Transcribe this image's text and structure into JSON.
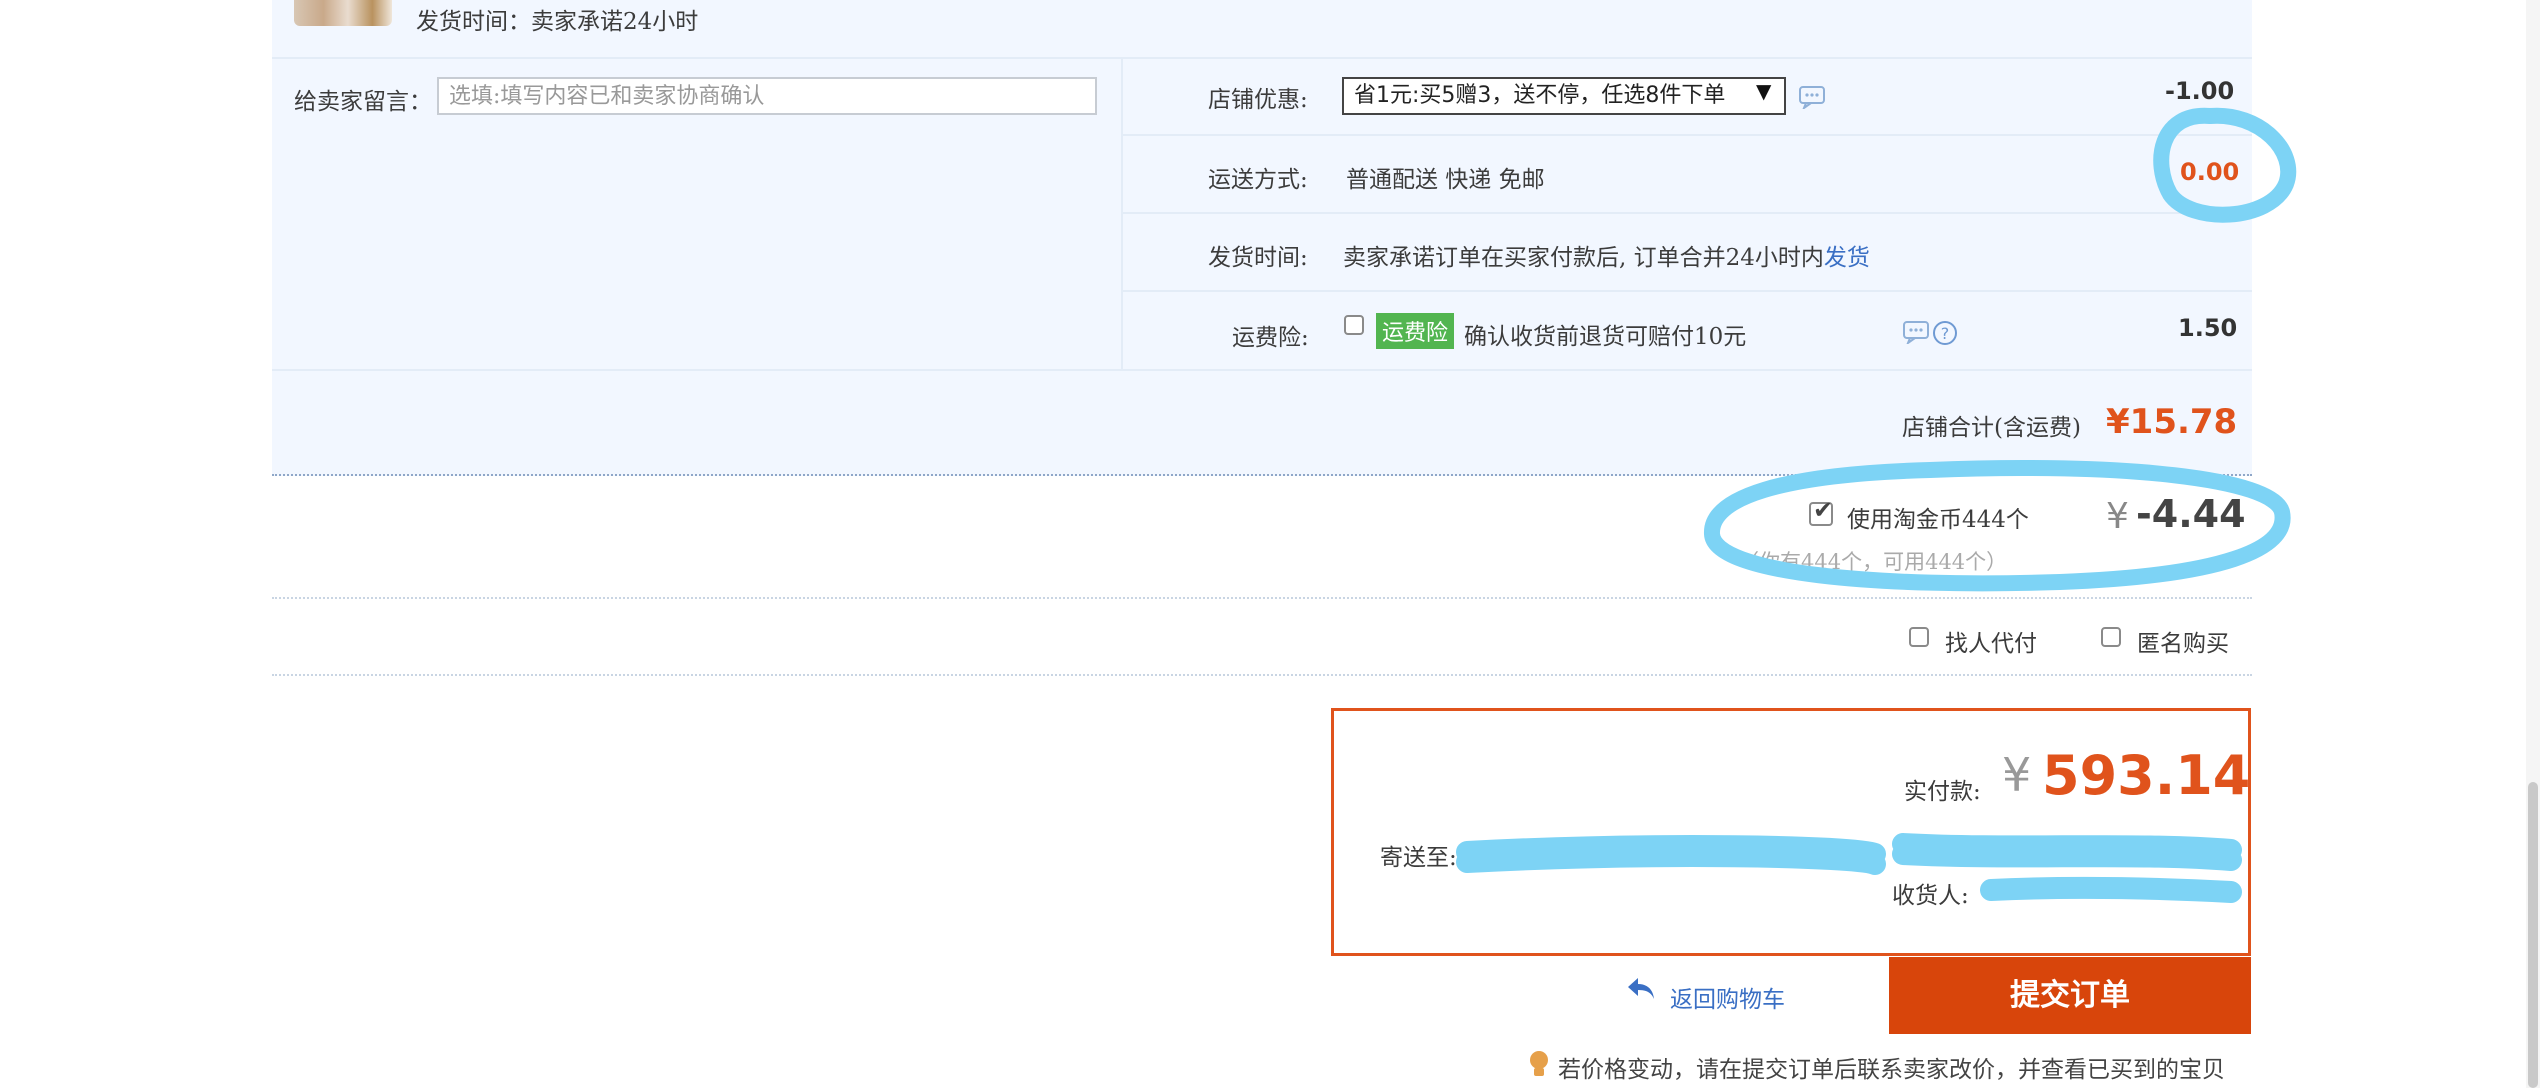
{
  "product": {
    "ship_time": "发货时间：卖家承诺24小时"
  },
  "message": {
    "label": "给卖家留言：",
    "placeholder": "选填:填写内容已和卖家协商确认"
  },
  "shop_discount": {
    "label": "店铺优惠:",
    "selected": "省1元:买5赠3，送不停，任选8件下单",
    "amount": "-1.00"
  },
  "shipping": {
    "label": "运送方式:",
    "value": "普通配送 快递 免邮",
    "amount": "0.00"
  },
  "delivery": {
    "label": "发货时间:",
    "value_prefix": "卖家承诺订单在买家付款后, 订单合并24小时内",
    "value_link": "发货"
  },
  "insurance": {
    "label": "运费险:",
    "badge": "运费险",
    "value": "确认收货前退货可赔付10元",
    "amount": "1.50"
  },
  "shop_total": {
    "label": "店铺合计(含运费)",
    "amount": "¥15.78"
  },
  "coins": {
    "label": "使用淘金币444个",
    "currency": "¥",
    "amount": "-4.44",
    "note": "（你有444个，可用444个）"
  },
  "options": {
    "proxy_pay": "找人代付",
    "anonymous": "匿名购买"
  },
  "payment": {
    "label": "实付款:",
    "currency": "¥",
    "amount": "593.14",
    "ship_to_label": "寄送至:",
    "recipient_label": "收货人:"
  },
  "actions": {
    "back_to_cart": "返回购物车",
    "submit": "提交订单"
  },
  "footer_tip": "若价格变动，请在提交订单后联系卖家改价，并查看已买到的宝贝",
  "colors": {
    "accent": "#d8450b",
    "price": "#e0531c",
    "panel": "#f2f7ff",
    "link": "#3a6fc4",
    "scribble": "#7dd3f5"
  }
}
